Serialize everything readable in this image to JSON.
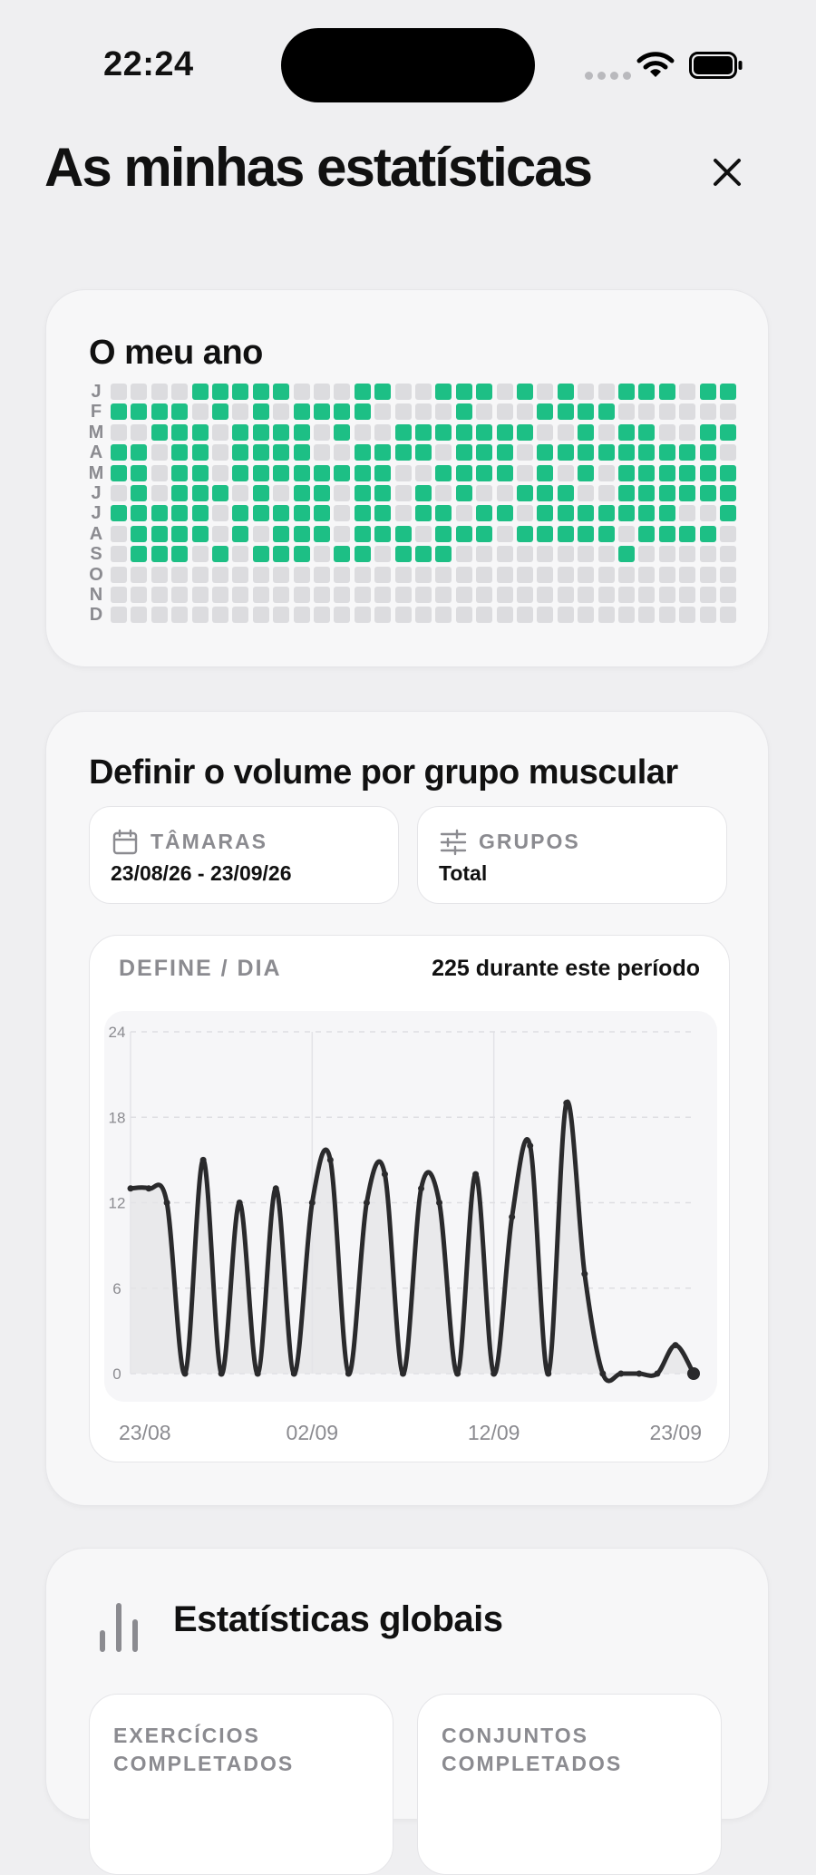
{
  "status_bar": {
    "time": "22:24"
  },
  "header": {
    "title": "As minhas estatísticas"
  },
  "year_card": {
    "title": "O meu ano",
    "month_labels": [
      "J",
      "F",
      "M",
      "A",
      "M",
      "J",
      "J",
      "A",
      "S",
      "O",
      "N",
      "D"
    ],
    "grid": [
      "0000111110001100111010100111011001110",
      "11110101011110000100011110000000000000",
      "001110111101001111111001011001110110",
      "11011011110011110111011111111101101",
      "110110111111110011110101011111111011",
      "01011101011011010100111001111111110",
      "11111011111011011011011111110011001111",
      "01111010111011101110111110111101101011",
      "011101011101101110000000010000000000",
      "0000000000000000000000000000000000000",
      "000000000000000000000000000000000000",
      "0000000000000000000000000000000000000"
    ],
    "active_color": "#1dbf85",
    "empty_color": "#dcdcdf"
  },
  "volume_card": {
    "title": "Definir o volume por grupo muscular",
    "dates_filter": {
      "label": "TÂMARAS",
      "value": "23/08/26 - 23/09/26"
    },
    "groups_filter": {
      "label": "GRUPOS",
      "value": "Total"
    },
    "chart_header": {
      "label": "DEFINE / DIA",
      "total": "225 durante este período"
    }
  },
  "chart_data": {
    "type": "line",
    "title": "",
    "x": [
      "23/08",
      "24/08",
      "25/08",
      "26/08",
      "27/08",
      "28/08",
      "29/08",
      "30/08",
      "31/08",
      "01/09",
      "02/09",
      "03/09",
      "04/09",
      "05/09",
      "06/09",
      "07/09",
      "08/09",
      "09/09",
      "10/09",
      "11/09",
      "12/09",
      "13/09",
      "14/09",
      "15/09",
      "16/09",
      "17/09",
      "18/09",
      "19/09",
      "20/09",
      "21/09",
      "22/09",
      "23/09"
    ],
    "series": [
      {
        "values": [
          13,
          13,
          12,
          0,
          15,
          0,
          12,
          0,
          13,
          0,
          12,
          15,
          0,
          12,
          14,
          0,
          13,
          12,
          0,
          14,
          0,
          11,
          16,
          0,
          19,
          7,
          0,
          0,
          0,
          0,
          2,
          0
        ]
      }
    ],
    "x_tick_labels": [
      "23/08",
      "02/09",
      "12/09",
      "23/09"
    ],
    "y_ticks": [
      0,
      6,
      12,
      18,
      24
    ],
    "ylim": [
      0,
      24
    ],
    "grid": true,
    "line_color": "#2a2a2c"
  },
  "global_card": {
    "title": "Estatísticas globais",
    "tiles": [
      {
        "label": "EXERCÍCIOS COMPLETADOS"
      },
      {
        "label": "CONJUNTOS COMPLETADOS"
      }
    ]
  }
}
